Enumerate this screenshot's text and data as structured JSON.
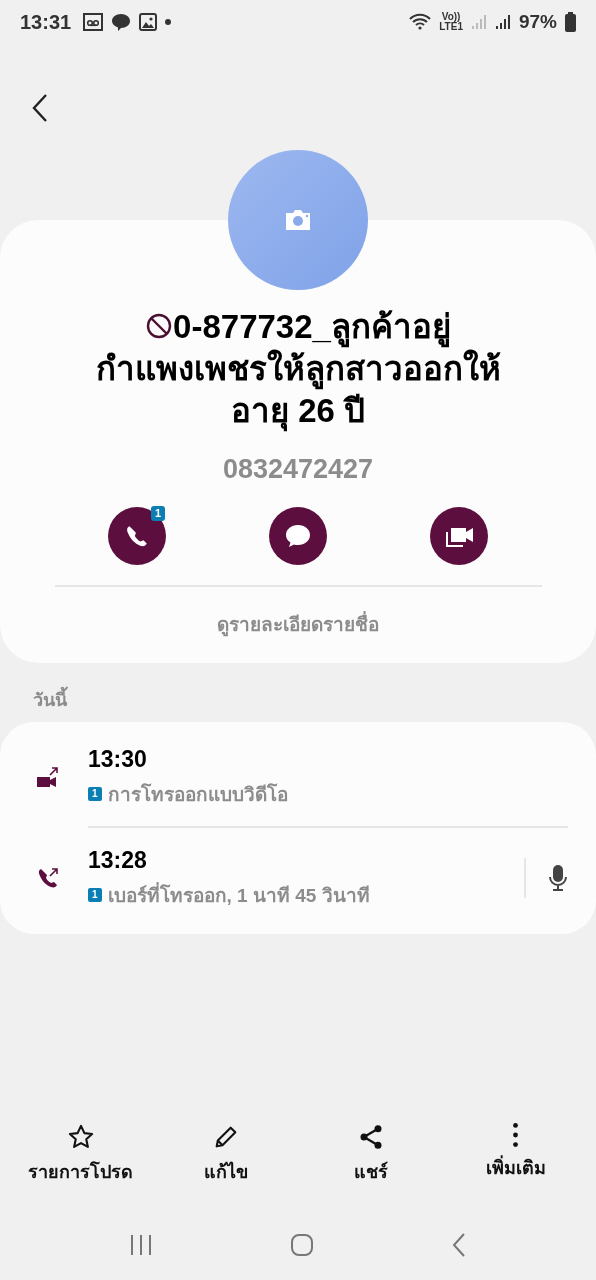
{
  "status_bar": {
    "time": "13:31",
    "network": "Vo))",
    "network_type": "LTE1",
    "battery": "97%"
  },
  "contact": {
    "blocked": true,
    "name": "0-877732_ลูกค้าอยู่กำแพงเพชรให้ลูกสาวออกให้อายุ 26 ปี",
    "number": "0832472427",
    "call_badge": "1",
    "details_link": "ดูรายละเอียดรายชื่อ"
  },
  "history": {
    "section": "วันนี้",
    "calls": [
      {
        "kind": "video",
        "time": "13:30",
        "sim": "1",
        "description": "การโทรออกแบบวิดีโอ",
        "recording": false
      },
      {
        "kind": "voice",
        "time": "13:28",
        "sim": "1",
        "description": "เบอร์ที่โทรออก, 1 นาที 45 วินาที",
        "recording": true
      }
    ]
  },
  "bottom_actions": [
    {
      "kind": "favorite",
      "label": "รายการโปรด"
    },
    {
      "kind": "edit",
      "label": "แก้ไข"
    },
    {
      "kind": "share",
      "label": "แชร์"
    },
    {
      "kind": "more",
      "label": "เพิ่มเติม"
    }
  ]
}
